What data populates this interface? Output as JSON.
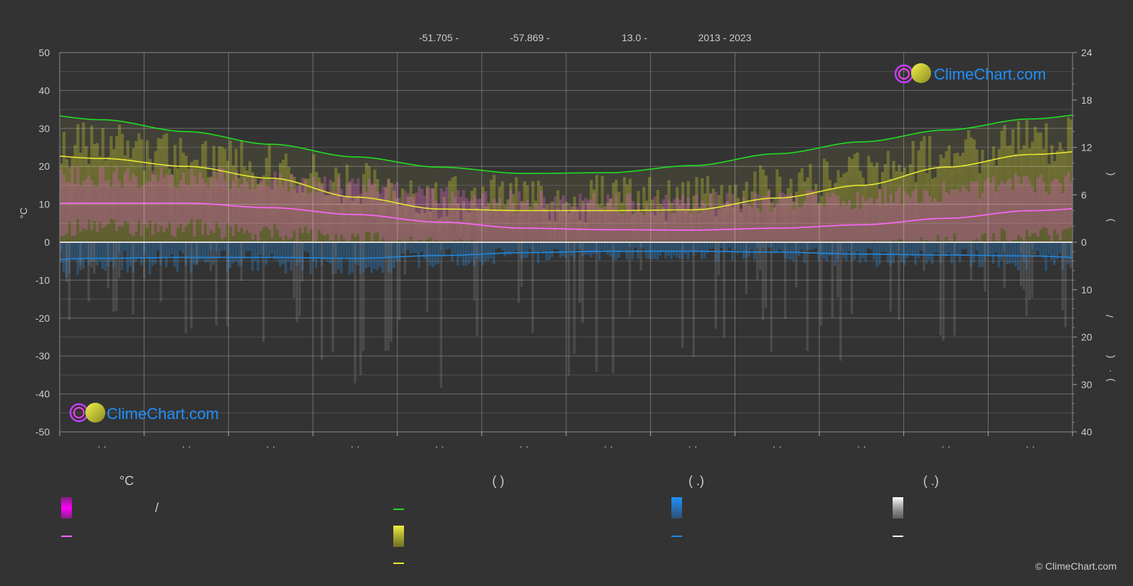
{
  "header": {
    "latitude": "-51.705 -",
    "longitude": "-57.869 -",
    "elevation": "13.0 -",
    "years": "2013 - 2023"
  },
  "logo": {
    "text": "ClimeChart.com"
  },
  "copyright": "© ClimeChart.com",
  "colors": {
    "background": "#333333",
    "daylight": "#22dd22",
    "sunshine": "#e8e830",
    "temperature": "#ff66ff",
    "precipitation": "#2288dd",
    "snow": "#ffffff",
    "logo_text": "#1e90ff",
    "logo_ring": "#c040ff",
    "logo_sun": "#d4d430"
  },
  "chart_data": {
    "type": "line",
    "left_axis": {
      "label": "°C",
      "ticks": [
        "50",
        "40",
        "30",
        "20",
        "10",
        "0",
        "-10",
        "-20",
        "-30",
        "-40",
        "-50"
      ],
      "range": [
        -50,
        50
      ]
    },
    "right_axis_top": {
      "ticks": [
        "24",
        "18",
        "12",
        "6",
        "0"
      ],
      "range": [
        0,
        24
      ],
      "label_marks": [
        "(",
        ")"
      ]
    },
    "right_axis_bottom": {
      "ticks": [
        "0",
        "10",
        "20",
        "30",
        "40"
      ],
      "range": [
        0,
        40
      ],
      "label_marks": [
        "/",
        "(",
        "·",
        ")"
      ]
    },
    "x_months": 12,
    "month_labels": [
      "· ·",
      "· ·",
      "· ·",
      "· ·",
      "· ·",
      "· ·",
      "· ·",
      "· ·",
      "· ·",
      "· ·",
      "· ·",
      "· ·"
    ],
    "series": [
      {
        "key": "daylight",
        "values": [
          16.5,
          15.5,
          14.0,
          12.4,
          10.8,
          9.5,
          8.7,
          8.8,
          9.7,
          11.2,
          12.7,
          14.2,
          15.6,
          16.6,
          16.5
        ]
      },
      {
        "key": "sunshine",
        "values": [
          11.2,
          10.6,
          9.6,
          8.1,
          5.7,
          4.2,
          4.0,
          4.0,
          4.1,
          5.6,
          7.2,
          9.5,
          11.1,
          11.8,
          11.8
        ]
      },
      {
        "key": "temperature",
        "values": [
          10.3,
          10.3,
          10.3,
          9.1,
          7.3,
          5.3,
          3.7,
          3.3,
          3.2,
          3.7,
          4.6,
          6.3,
          8.3,
          9.4,
          9.6
        ]
      },
      {
        "key": "precipitation",
        "values": [
          3.8,
          3.4,
          3.2,
          3.2,
          3.4,
          2.8,
          2.2,
          1.9,
          1.9,
          2.1,
          2.5,
          2.7,
          2.9,
          3.6,
          3.8
        ]
      }
    ]
  },
  "legend": {
    "groups": [
      {
        "title": "°C",
        "items": [
          {
            "kind": "swatch",
            "label": "/"
          },
          {
            "kind": "line",
            "label": ""
          }
        ]
      },
      {
        "title": "(        )",
        "items": [
          {
            "kind": "line",
            "label": ""
          },
          {
            "kind": "swatch",
            "label": ""
          },
          {
            "kind": "line",
            "label": ""
          }
        ]
      },
      {
        "title": "(   .)",
        "items": [
          {
            "kind": "swatch",
            "label": ""
          },
          {
            "kind": "line",
            "label": ""
          }
        ]
      },
      {
        "title": "(   .)",
        "items": [
          {
            "kind": "swatch",
            "label": ""
          },
          {
            "kind": "line",
            "label": ""
          }
        ]
      }
    ]
  }
}
